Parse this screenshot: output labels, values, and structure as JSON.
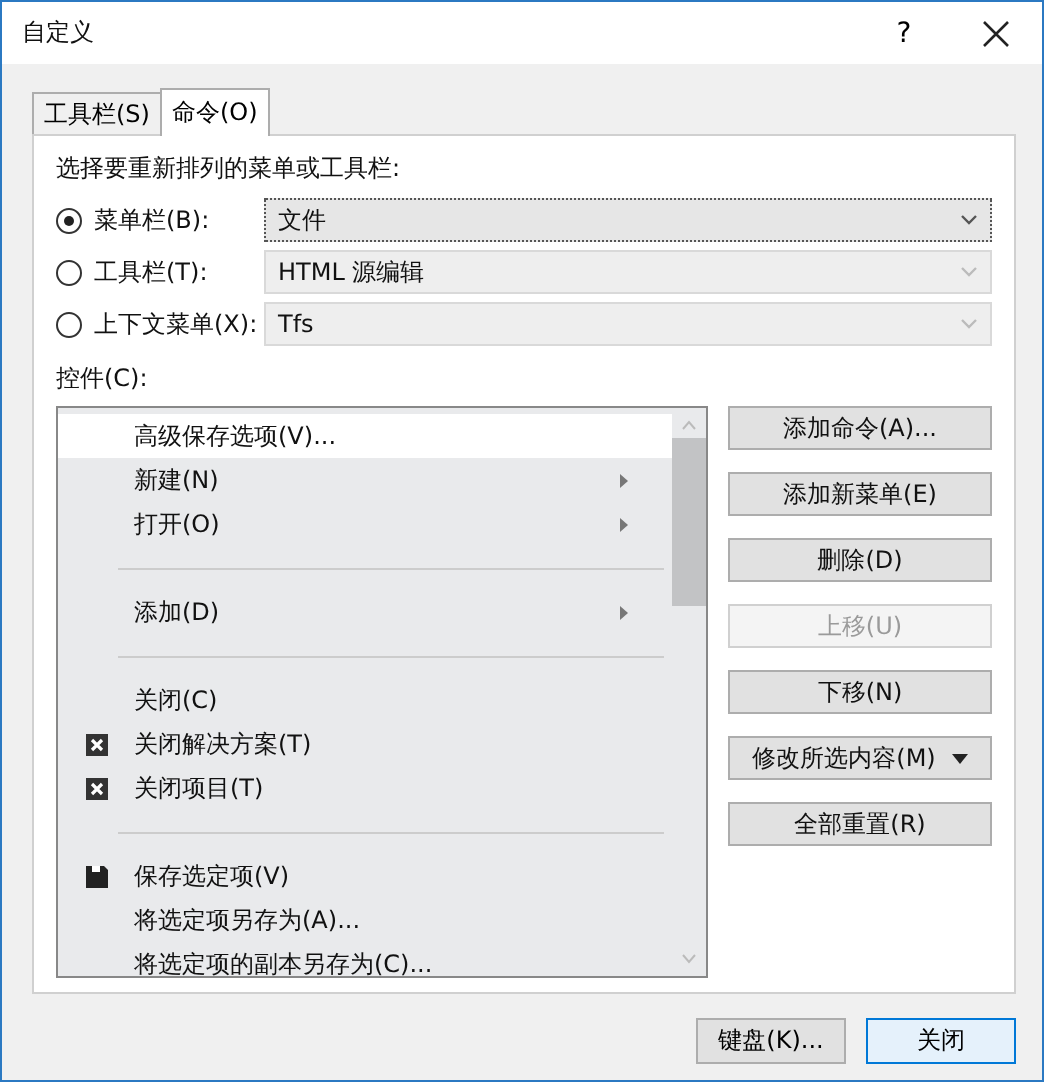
{
  "window": {
    "title": "自定义",
    "help": "?"
  },
  "tabs": [
    {
      "label": "工具栏(S)",
      "selected": false
    },
    {
      "label": "命令(O)",
      "selected": true
    }
  ],
  "prompt": "选择要重新排列的菜单或工具栏:",
  "choices": [
    {
      "label": "菜单栏(B):",
      "selected": true,
      "value": "文件"
    },
    {
      "label": "工具栏(T):",
      "selected": false,
      "value": "HTML 源编辑"
    },
    {
      "label": "上下文菜单(X):",
      "selected": false,
      "value": "Tfs"
    }
  ],
  "controls_label": "控件(C):",
  "controls": [
    {
      "kind": "item",
      "label": "高级保存选项(V)...",
      "selected": true,
      "submenu": false
    },
    {
      "kind": "item",
      "label": "新建(N)",
      "selected": false,
      "submenu": true
    },
    {
      "kind": "item",
      "label": "打开(O)",
      "selected": false,
      "submenu": true
    },
    {
      "kind": "separator"
    },
    {
      "kind": "item",
      "label": "添加(D)",
      "selected": false,
      "submenu": true
    },
    {
      "kind": "separator"
    },
    {
      "kind": "item",
      "label": "关闭(C)",
      "selected": false,
      "submenu": false
    },
    {
      "kind": "closer",
      "label": "关闭解决方案(T)",
      "selected": false,
      "submenu": false
    },
    {
      "kind": "closer",
      "label": "关闭项目(T)",
      "selected": false,
      "submenu": false
    },
    {
      "kind": "separator"
    },
    {
      "kind": "saver",
      "label": "保存选定项(V)",
      "selected": false,
      "submenu": false
    },
    {
      "kind": "item",
      "label": "将选定项另存为(A)...",
      "selected": false,
      "submenu": false
    },
    {
      "kind": "item",
      "label": "将选定项的副本另存为(C)...",
      "selected": false,
      "submenu": false
    }
  ],
  "actions": [
    {
      "label": "添加命令(A)...",
      "disabled": false,
      "dropdown": false
    },
    {
      "label": "添加新菜单(E)",
      "disabled": false,
      "dropdown": false
    },
    {
      "label": "删除(D)",
      "disabled": false,
      "dropdown": false
    },
    {
      "label": "上移(U)",
      "disabled": true,
      "dropdown": false
    },
    {
      "label": "下移(N)",
      "disabled": false,
      "dropdown": false
    },
    {
      "label": "修改所选内容(M)",
      "disabled": false,
      "dropdown": true
    },
    {
      "label": "全部重置(R)",
      "disabled": false,
      "dropdown": false
    }
  ],
  "footer_buttons": [
    {
      "label": "键盘(K)...",
      "default": false
    },
    {
      "label": "关闭",
      "default": true
    }
  ]
}
